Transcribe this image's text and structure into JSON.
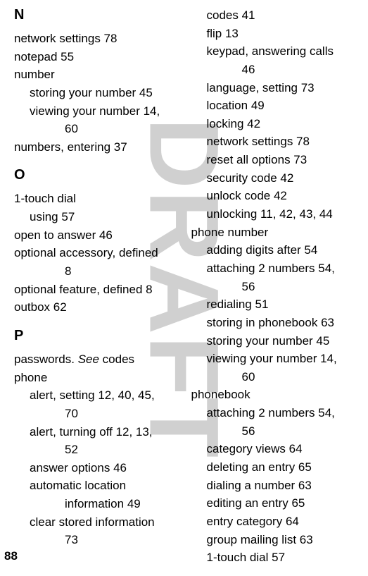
{
  "page_number": "88",
  "watermark": "DRAFT",
  "left_column": {
    "sections": {
      "N": {
        "header": "N",
        "lines": [
          {
            "text": "network settings  78",
            "indent": 0
          },
          {
            "text": "notepad  55",
            "indent": 0
          },
          {
            "text": "number",
            "indent": 0
          },
          {
            "text": "storing your number  45",
            "indent": 1
          },
          {
            "text": "viewing your number  14,",
            "indent": 1
          },
          {
            "text": "60",
            "indent": 2
          },
          {
            "text": "numbers, entering  37",
            "indent": 0
          }
        ]
      },
      "O": {
        "header": "O",
        "lines": [
          {
            "text": "1-touch dial",
            "indent": 0
          },
          {
            "text": "using  57",
            "indent": 1
          },
          {
            "text": "open to answer  46",
            "indent": 0
          },
          {
            "text": "optional accessory, defined",
            "indent": 0
          },
          {
            "text": "8",
            "indent": 2
          },
          {
            "text": "optional feature, defined  8",
            "indent": 0
          },
          {
            "text": "outbox  62",
            "indent": 0
          }
        ]
      },
      "P": {
        "header": "P",
        "lines": [
          {
            "text_prefix": "passwords. ",
            "text_italic": "See",
            "text_suffix": " codes",
            "indent": 0,
            "has_italic": true
          },
          {
            "text": "phone",
            "indent": 0
          },
          {
            "text": "alert, setting  12, 40, 45,",
            "indent": 1
          },
          {
            "text": "70",
            "indent": 2
          },
          {
            "text": "alert, turning off  12, 13,",
            "indent": 1
          },
          {
            "text": "52",
            "indent": 2
          },
          {
            "text": "answer options  46",
            "indent": 1
          },
          {
            "text": "automatic location",
            "indent": 1
          },
          {
            "text": "information  49",
            "indent": 2
          },
          {
            "text": "clear stored information",
            "indent": 1
          },
          {
            "text": "73",
            "indent": 2
          }
        ]
      }
    }
  },
  "right_column": {
    "lines": [
      {
        "text": "codes  41",
        "indent": 1
      },
      {
        "text": "flip  13",
        "indent": 1
      },
      {
        "text": "keypad, answering calls",
        "indent": 1
      },
      {
        "text": "46",
        "indent": 2
      },
      {
        "text": "language, setting  73",
        "indent": 1
      },
      {
        "text": "location  49",
        "indent": 1
      },
      {
        "text": "locking  42",
        "indent": 1
      },
      {
        "text": "network settings  78",
        "indent": 1
      },
      {
        "text": "reset all options  73",
        "indent": 1
      },
      {
        "text": "security code  42",
        "indent": 1
      },
      {
        "text": "unlock code  42",
        "indent": 1
      },
      {
        "text": "unlocking  11, 42, 43, 44",
        "indent": 1
      },
      {
        "text": "phone number",
        "indent": 0
      },
      {
        "text": "adding digits after  54",
        "indent": 1
      },
      {
        "text": "attaching 2 numbers  54,",
        "indent": 1
      },
      {
        "text": "56",
        "indent": 2
      },
      {
        "text": "redialing  51",
        "indent": 1
      },
      {
        "text": "storing in phonebook  63",
        "indent": 1
      },
      {
        "text": "storing your number  45",
        "indent": 1
      },
      {
        "text": "viewing your number  14,",
        "indent": 1
      },
      {
        "text": "60",
        "indent": 2
      },
      {
        "text": "phonebook",
        "indent": 0
      },
      {
        "text": "attaching 2 numbers  54,",
        "indent": 1
      },
      {
        "text": "56",
        "indent": 2
      },
      {
        "text": "category views  64",
        "indent": 1
      },
      {
        "text": "deleting an entry  65",
        "indent": 1
      },
      {
        "text": "dialing a number  63",
        "indent": 1
      },
      {
        "text": "editing an entry  65",
        "indent": 1
      },
      {
        "text": "entry category  64",
        "indent": 1
      },
      {
        "text": "group mailing list  63",
        "indent": 1
      },
      {
        "text": "1-touch dial  57",
        "indent": 1
      }
    ]
  }
}
